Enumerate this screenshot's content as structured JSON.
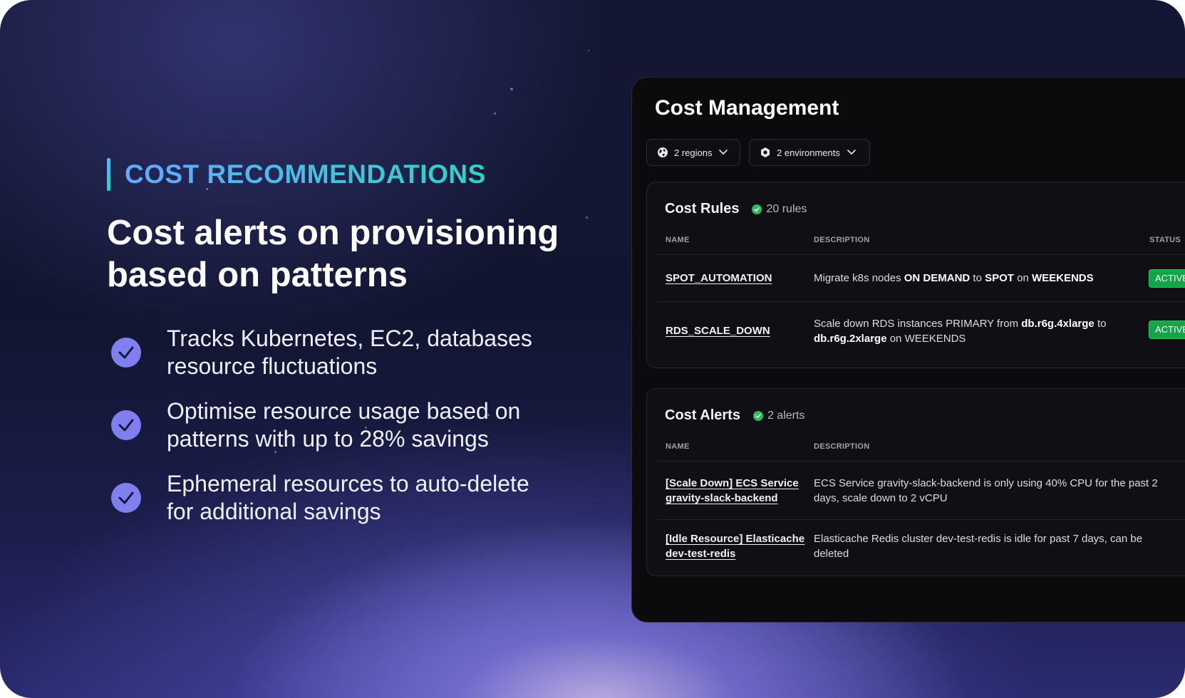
{
  "hero": {
    "eyebrow": "COST RECOMMENDATIONS",
    "headline": "Cost alerts on provisioning based on patterns",
    "features": [
      {
        "text": "Tracks Kubernetes, EC2, databases resource fluctuations",
        "icon": "check-circle-icon"
      },
      {
        "text": "Optimise resource usage based on patterns with up to 28% savings",
        "icon": "check-circle-icon"
      },
      {
        "text": "Ephemeral resources to auto-delete for additional savings",
        "icon": "check-circle-icon"
      }
    ]
  },
  "panel": {
    "title": "Cost Management",
    "filters": [
      {
        "label": "2 regions",
        "icon": "globe-icon"
      },
      {
        "label": "2 environments",
        "icon": "environment-icon"
      }
    ],
    "cost_rules": {
      "title": "Cost Rules",
      "count": "20 rules",
      "columns": {
        "name": "NAME",
        "description": "DESCRIPTION",
        "status": "STATUS"
      },
      "rows": [
        {
          "name": "SPOT_AUTOMATION",
          "desc": [
            {
              "t": "Migrate k8s nodes ",
              "b": false
            },
            {
              "t": "ON DEMAND",
              "b": true
            },
            {
              "t": " to ",
              "b": false
            },
            {
              "t": "SPOT",
              "b": true
            },
            {
              "t": " on ",
              "b": false
            },
            {
              "t": "WEEKENDS",
              "b": true
            }
          ],
          "status": "ACTIVE"
        },
        {
          "name": "RDS_SCALE_DOWN",
          "desc": [
            {
              "t": "Scale down RDS instances PRIMARY from ",
              "b": false
            },
            {
              "t": "db.r6g.4xlarge",
              "b": true
            },
            {
              "t": " to ",
              "b": false
            },
            {
              "t": "db.r6g.2xlarge",
              "b": true
            },
            {
              "t": " on WEEKENDS",
              "b": false
            }
          ],
          "status": "ACTIVE"
        }
      ]
    },
    "cost_alerts": {
      "title": "Cost Alerts",
      "count": "2 alerts",
      "columns": {
        "name": "NAME",
        "description": "DESCRIPTION"
      },
      "rows": [
        {
          "name": "[Scale Down] ECS Service gravity-slack-backend",
          "description": "ECS Service gravity-slack-backend is only using 40% CPU for the past 2 days, scale down to 2 vCPU"
        },
        {
          "name": "[Idle Resource] Elasticache dev-test-redis",
          "description": "Elasticache Redis cluster dev-test-redis is idle for past 7 days, can be deleted"
        }
      ]
    },
    "colors": {
      "status_active": "#16a34a",
      "count_ok": "#2fb864",
      "accent": "#7f7ff0"
    }
  }
}
